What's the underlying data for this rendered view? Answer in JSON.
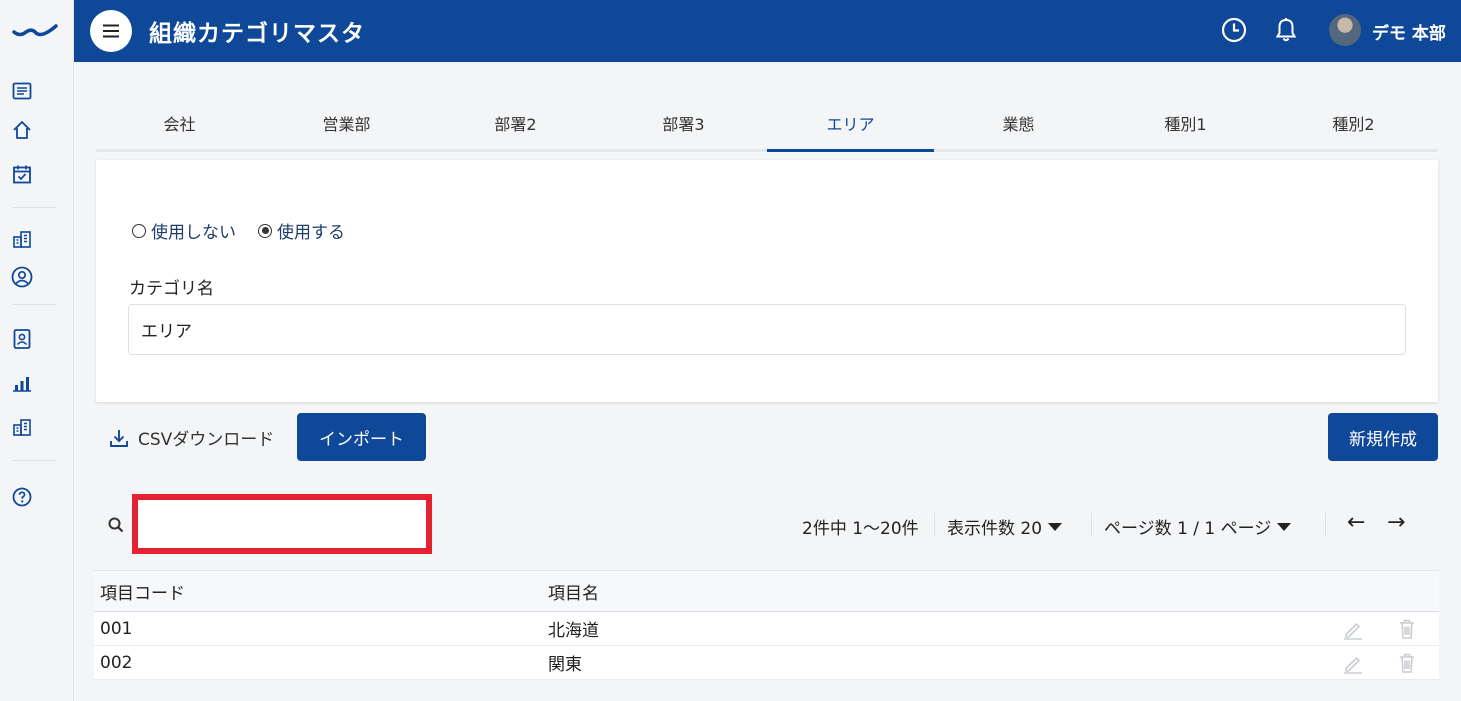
{
  "header": {
    "title": "組織カテゴリマスタ",
    "user_name": "デモ 本部"
  },
  "sidebar": {
    "icons": [
      "list-icon",
      "home-icon",
      "calendar-check-icon",
      "building-icon",
      "user-circle-icon",
      "id-badge-icon",
      "bar-chart-icon",
      "office-icon",
      "help-icon"
    ]
  },
  "tabs": [
    "会社",
    "営業部",
    "部署2",
    "部署3",
    "エリア",
    "業態",
    "種別1",
    "種別2"
  ],
  "active_tab": "エリア",
  "form": {
    "radio_off_label": "使用しない",
    "radio_on_label": "使用する",
    "selected": "使用する",
    "category_label": "カテゴリ名",
    "category_value": "エリア"
  },
  "actions": {
    "csv_download": "CSVダウンロード",
    "import": "インポート",
    "create": "新規作成"
  },
  "search": {
    "value": "",
    "placeholder": ""
  },
  "pagination": {
    "summary": "2件中 1〜20件",
    "per_page": "表示件数 20",
    "page": "ページ数 1 / 1 ページ",
    "prev": "←",
    "next": "→"
  },
  "table": {
    "columns": [
      "項目コード",
      "項目名"
    ],
    "rows": [
      {
        "code": "001",
        "name": "北海道"
      },
      {
        "code": "002",
        "name": "関東"
      }
    ]
  },
  "colors": {
    "primary": "#0f4898",
    "highlight": "#e5222f"
  }
}
